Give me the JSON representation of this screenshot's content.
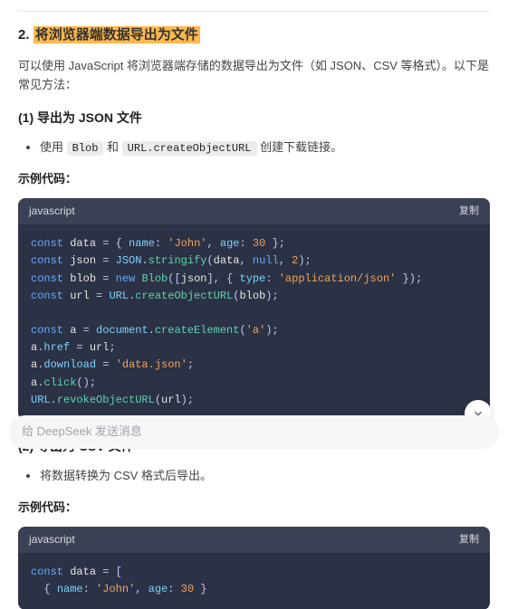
{
  "heading": {
    "num": "2.",
    "title": "将浏览器端数据导出为文件"
  },
  "desc": "可以使用 JavaScript 将浏览器端存储的数据导出为文件（如 JSON、CSV 等格式）。以下是常见方法：",
  "sec1": {
    "title": "(1) 导出为 JSON 文件",
    "bullet_pre": "使用 ",
    "code1": "Blob",
    "bullet_mid": " 和 ",
    "code2": "URL.createObjectURL",
    "bullet_post": " 创建下载链接。",
    "ex": "示例代码：",
    "lang": "javascript",
    "copy": "复制"
  },
  "sec2": {
    "title": "(2) 导出为 CSV 文件",
    "bullet": "将数据转换为 CSV 格式后导出。",
    "ex": "示例代码：",
    "lang": "javascript",
    "copy": "复制"
  },
  "code1": {
    "l1": {
      "kw": "const",
      "v": "data",
      "eq": " = { ",
      "k1": "name",
      "c1": ": ",
      "s1": "'John'",
      "c2": ", ",
      "k2": "age",
      "c3": ": ",
      "n1": "30",
      "end": " };"
    },
    "l2": {
      "kw": "const",
      "v": "json",
      "eq": " = ",
      "o": "JSON",
      "d": ".",
      "f": "stringify",
      "a": "(",
      "v1": "data",
      "c1": ", ",
      "n1": "null",
      "c2": ", ",
      "n2": "2",
      "e": ");"
    },
    "l3": {
      "kw": "const",
      "v": "blob",
      "eq": " = ",
      "nw": "new",
      "sp": " ",
      "cls": "Blob",
      "a": "([",
      "v1": "json",
      "m": "], { ",
      "k": "type",
      "c": ": ",
      "s": "'application/json'",
      "e": " });"
    },
    "l4": {
      "kw": "const",
      "v": "url",
      "eq": " = ",
      "o": "URL",
      "d": ".",
      "f": "createObjectURL",
      "a": "(",
      "v1": "blob",
      "e": ");"
    },
    "l6": {
      "kw": "const",
      "v": "a",
      "eq": " = ",
      "o": "document",
      "d": ".",
      "f": "createElement",
      "a": "(",
      "s": "'a'",
      "e": ");"
    },
    "l7": {
      "v": "a",
      "d": ".",
      "p": "href",
      "eq": " = ",
      "v2": "url",
      "e": ";"
    },
    "l8": {
      "v": "a",
      "d": ".",
      "p": "download",
      "eq": " = ",
      "s": "'data.json'",
      "e": ";"
    },
    "l9": {
      "v": "a",
      "d": ".",
      "f": "click",
      "a": "();"
    },
    "l10": {
      "o": "URL",
      "d": ".",
      "f": "revokeObjectURL",
      "a": "(",
      "v": "url",
      "e": ");"
    }
  },
  "code2": {
    "l1": {
      "kw": "const",
      "v": "data",
      "eq": " = ["
    },
    "l2": {
      "pad": "  { ",
      "k1": "name",
      "c1": ": ",
      "s1": "'John'",
      "c2": ", ",
      "k2": "age",
      "c3": ": ",
      "n1": "30",
      "end": " }"
    }
  },
  "input": {
    "placeholder": "给 DeepSeek 发送消息"
  }
}
